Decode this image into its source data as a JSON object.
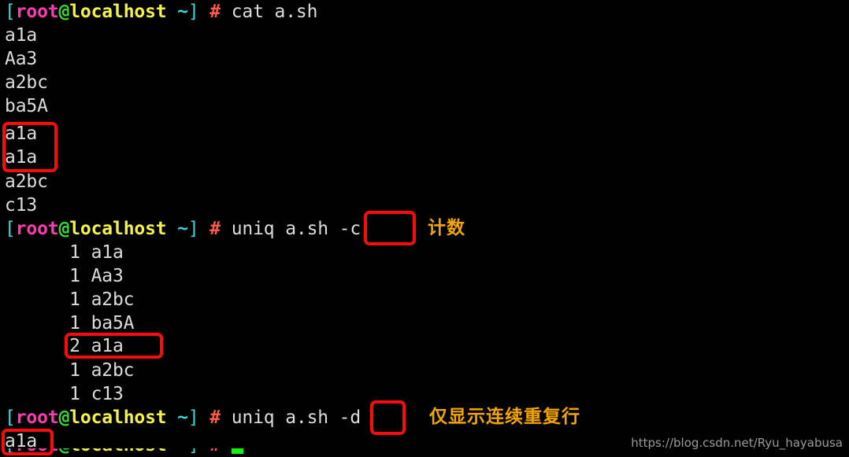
{
  "terminal": {
    "background_color": "#000000",
    "foreground_color": "#dcdcdc",
    "prompt": {
      "open_bracket": "[",
      "user": "root",
      "at": "@",
      "host": "localhost",
      "path": " ~",
      "close_bracket": "]",
      "sigil": "#",
      "colors": {
        "bracket": "#39d8d8",
        "user": "#ff3ab0",
        "at": "#33dd33",
        "host": "#f2f24a",
        "sigil": "#ff5a47",
        "command": "#dcdcdc"
      }
    },
    "lines": [
      {
        "kind": "prompt",
        "command": "cat a.sh"
      },
      {
        "kind": "output",
        "text": "a1a"
      },
      {
        "kind": "output",
        "text": "Aa3"
      },
      {
        "kind": "output",
        "text": "a2bc"
      },
      {
        "kind": "output",
        "text": "ba5A"
      },
      {
        "kind": "output",
        "text": "a1a"
      },
      {
        "kind": "output",
        "text": "a1a"
      },
      {
        "kind": "output",
        "text": "a2bc"
      },
      {
        "kind": "output",
        "text": "c13"
      },
      {
        "kind": "prompt",
        "command": "uniq a.sh -c"
      },
      {
        "kind": "output",
        "text": "      1 a1a"
      },
      {
        "kind": "output",
        "text": "      1 Aa3"
      },
      {
        "kind": "output",
        "text": "      1 a2bc"
      },
      {
        "kind": "output",
        "text": "      1 ba5A"
      },
      {
        "kind": "output",
        "text": "      2 a1a"
      },
      {
        "kind": "output",
        "text": "      1 a2bc"
      },
      {
        "kind": "output",
        "text": "      1 c13"
      },
      {
        "kind": "prompt",
        "command": "uniq a.sh -d"
      },
      {
        "kind": "output",
        "text": "a1a"
      }
    ]
  },
  "annotations": {
    "box_color": "#fb0b0b",
    "note_color": "#f2a500",
    "notes": [
      {
        "id": "count-note",
        "text": "计数"
      },
      {
        "id": "dup-note",
        "text": "仅显示连续重复行"
      }
    ],
    "boxes": [
      {
        "id": "duplicate-input-lines-box",
        "target": "a1a a1a"
      },
      {
        "id": "flag-c-box",
        "target": "-c"
      },
      {
        "id": "count-2-row-box",
        "target": "2 a1a"
      },
      {
        "id": "flag-d-box",
        "target": "-d"
      },
      {
        "id": "duplicate-output-box",
        "target": "a1a"
      }
    ]
  },
  "watermark": {
    "text": "https://blog.csdn.net/Ryu_hayabusa"
  }
}
